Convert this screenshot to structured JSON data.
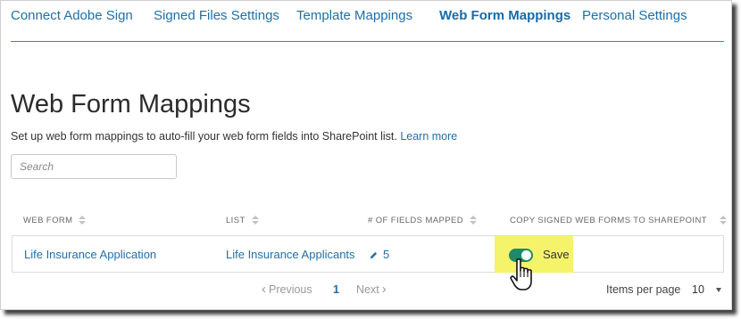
{
  "nav": {
    "tabs": [
      {
        "label": "Connect Adobe Sign"
      },
      {
        "label": "Signed Files Settings"
      },
      {
        "label": "Template Mappings"
      },
      {
        "label": "Web Form Mappings",
        "active": true
      },
      {
        "label": "Personal Settings"
      }
    ]
  },
  "page": {
    "title": "Web Form Mappings",
    "description": "Set up web form mappings to auto-fill your web form fields into SharePoint list.",
    "learn_more": "Learn more"
  },
  "search": {
    "placeholder": "Search",
    "value": ""
  },
  "table": {
    "columns": [
      "WEB FORM",
      "LIST",
      "# OF FIELDS MAPPED",
      "COPY SIGNED WEB FORMS TO SHAREPOINT"
    ],
    "rows": [
      {
        "web_form": "Life Insurance Application",
        "list": "Life Insurance Applicants",
        "fields_mapped": "5",
        "copy_enabled": true,
        "save_label": "Save"
      }
    ]
  },
  "pagination": {
    "previous": "Previous",
    "current_page": "1",
    "next": "Next",
    "items_per_page_label": "Items per page",
    "items_per_page": "10"
  },
  "colors": {
    "link": "#1f6fa7",
    "toggle_on": "#1e8a6b",
    "highlight": "#f5f36a"
  }
}
